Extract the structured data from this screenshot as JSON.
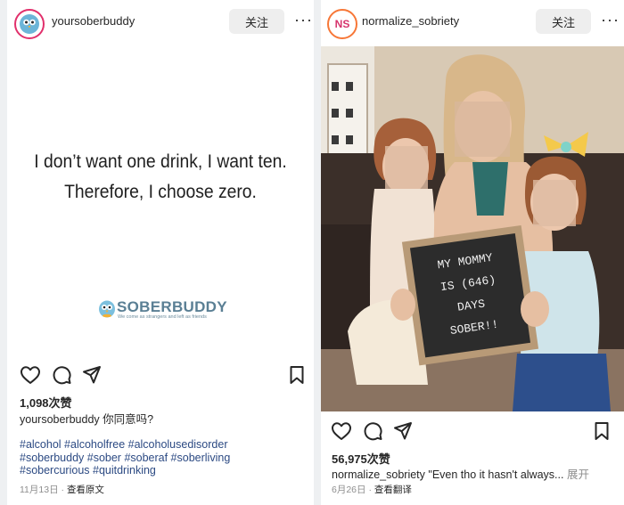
{
  "left_post": {
    "username": "yoursoberbuddy",
    "follow_label": "关注",
    "more_label": "···",
    "quote_line1": "I don’t want one drink, I want ten.",
    "quote_line2": "Therefore, I choose zero.",
    "brand_name": "SOBERBUDDY",
    "brand_tagline": "We come as strangers and left as friends",
    "likes": "1,098次赞",
    "caption_user": "yoursoberbuddy",
    "caption_text": "你同意吗?",
    "hashtags_line1": "#alcohol #alcoholfree #alcoholusedisorder",
    "hashtags_line2": "#soberbuddy #sober #soberaf #soberliving",
    "hashtags_line3": "#sobercurious #quitdrinking",
    "date": "11月13日",
    "separator": "·",
    "view_original": "查看原文"
  },
  "right_post": {
    "username": "normalize_sobriety",
    "avatar_initials": "NS",
    "follow_label": "关注",
    "more_label": "···",
    "sign_line1": "MY MOMMY",
    "sign_line2": "IS (646)",
    "sign_line3": "DAYS",
    "sign_line4": "SOBER!!",
    "likes": "56,975次赞",
    "caption_user": "normalize_sobriety",
    "caption_text": "\"Even tho it hasn't always...",
    "expand_label": "展开",
    "date": "6月26日",
    "separator": "·",
    "view_translation": "查看翻译"
  },
  "colors": {
    "hashtag": "#2c4a83",
    "meta_gray": "#8e8e8e",
    "follow_bg": "#eeeeee",
    "avatar_ring_pink": "#e1306c",
    "avatar_ring_orange": "#f77737",
    "brand_blue": "#5a7f94"
  },
  "icons": [
    "heart-icon",
    "comment-icon",
    "share-icon",
    "bookmark-icon",
    "owl-mascot-icon"
  ]
}
